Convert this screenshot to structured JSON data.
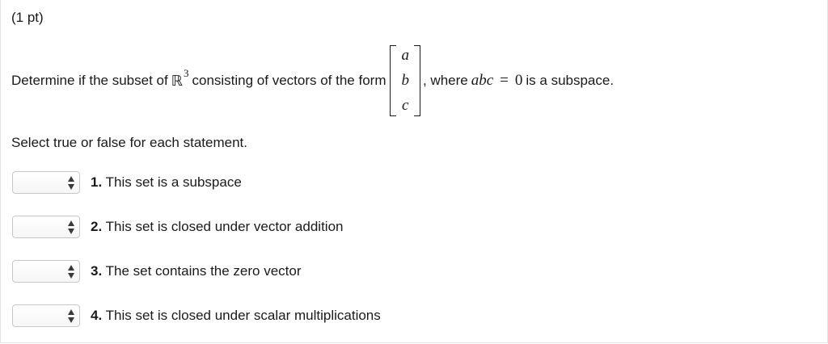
{
  "header": {
    "points": "(1 pt)"
  },
  "question": {
    "prefix": "Determine if the subset of",
    "space_symbol": "ℝ",
    "space_exponent": "3",
    "middle": "consisting of vectors of the form",
    "vector_entries": [
      "a",
      "b",
      "c"
    ],
    "comma_where": ", where",
    "condition_lhs": "abc",
    "condition_eq": "=",
    "condition_rhs": "0",
    "suffix": "is a subspace."
  },
  "instruction": "Select true or false for each statement.",
  "statements": [
    {
      "number": "1.",
      "text": "This set is a subspace",
      "selected": ""
    },
    {
      "number": "2.",
      "text": "This set is closed under vector addition",
      "selected": ""
    },
    {
      "number": "3.",
      "text": "The set contains the zero vector",
      "selected": ""
    },
    {
      "number": "4.",
      "text": "This set is closed under scalar multiplications",
      "selected": ""
    }
  ],
  "icons": {
    "select_arrows": "up-down-arrows-icon"
  }
}
